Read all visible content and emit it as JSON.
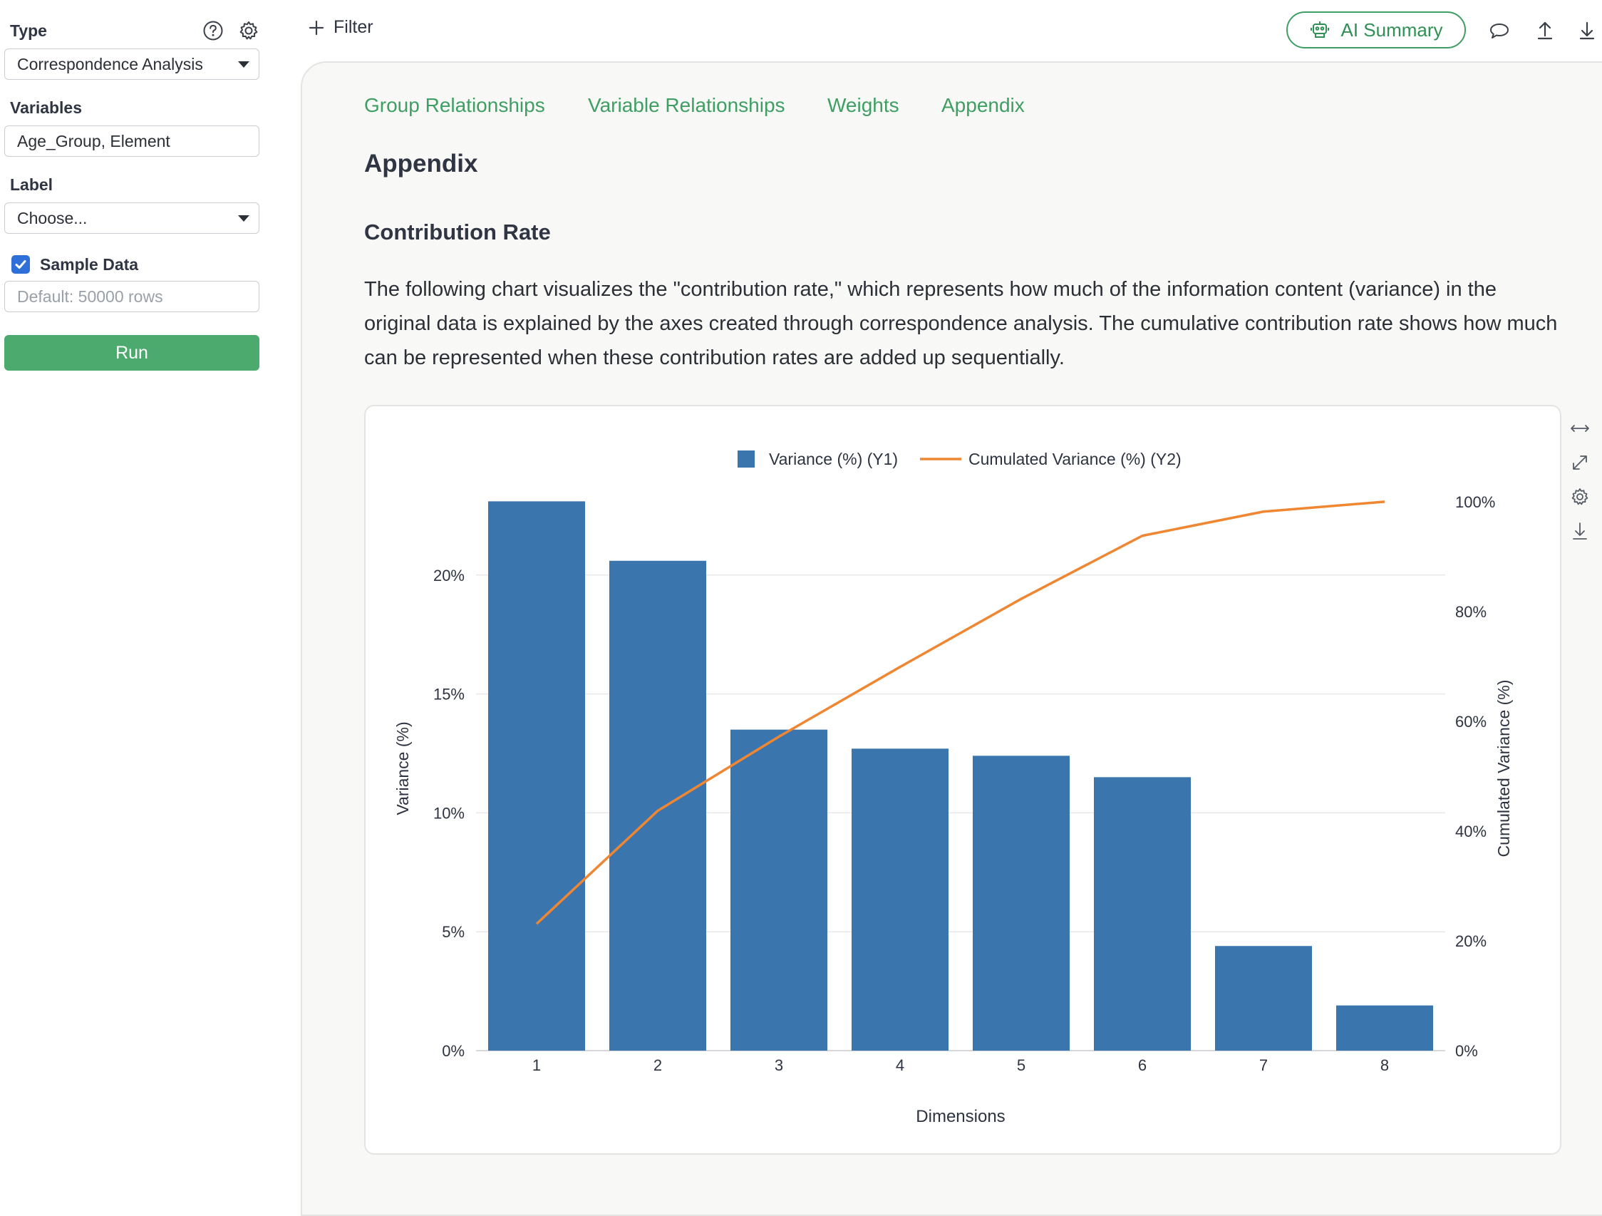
{
  "sidebar": {
    "type_label": "Type",
    "type_value": "Correspondence Analysis",
    "variables_label": "Variables",
    "variables_value": "Age_Group, Element",
    "label_label": "Label",
    "label_value": "Choose...",
    "sample_label": "Sample Data",
    "sample_checked": true,
    "sample_placeholder": "Default: 50000 rows",
    "run_label": "Run",
    "icons": [
      "help-icon",
      "gear-icon"
    ]
  },
  "topbar": {
    "filter_label": "Filter",
    "ai_summary_label": "AI Summary",
    "icons": [
      "robot-icon",
      "comment-icon",
      "upload-icon",
      "download-icon"
    ]
  },
  "tabs": [
    {
      "label": "Group Relationships"
    },
    {
      "label": "Variable Relationships"
    },
    {
      "label": "Weights"
    },
    {
      "label": "Appendix"
    }
  ],
  "content": {
    "title": "Appendix",
    "section_title": "Contribution Rate",
    "description": "The following chart visualizes the \"contribution rate,\" which represents how much of the information content (variance) in the original data is explained by the axes created through correspondence analysis. The cumulative contribution rate shows how much can be represented when these contribution rates are added up sequentially."
  },
  "colors": {
    "accent_green": "#4caa6e",
    "bar_blue": "#3a75ae",
    "line_orange": "#ef8632"
  },
  "chart_tools": [
    "expand-horizontal-icon",
    "fullscreen-icon",
    "settings-icon",
    "download-icon"
  ],
  "chart_data": {
    "type": "bar",
    "categories": [
      "1",
      "2",
      "3",
      "4",
      "5",
      "6",
      "7",
      "8"
    ],
    "series": [
      {
        "name": "Variance (%) (Y1)",
        "type": "bar",
        "axis": "y1",
        "values": [
          23.1,
          20.6,
          13.5,
          12.7,
          12.4,
          11.5,
          4.4,
          1.9
        ]
      },
      {
        "name": "Cumulated Variance (%) (Y2)",
        "type": "line",
        "axis": "y2",
        "values": [
          23.1,
          43.7,
          57.2,
          69.9,
          82.3,
          93.8,
          98.2,
          100
        ]
      }
    ],
    "xlabel": "Dimensions",
    "ylabel": "Variance (%)",
    "y2label": "Cumulated Variance (%)",
    "y1_ticks": [
      "0%",
      "5%",
      "10%",
      "15%",
      "20%"
    ],
    "y2_ticks": [
      "0%",
      "20%",
      "40%",
      "60%",
      "80%",
      "100%"
    ],
    "y1lim": [
      0,
      24.1
    ],
    "y2lim": [
      0,
      104.4
    ],
    "legend_position": "top-center",
    "grid": true
  }
}
